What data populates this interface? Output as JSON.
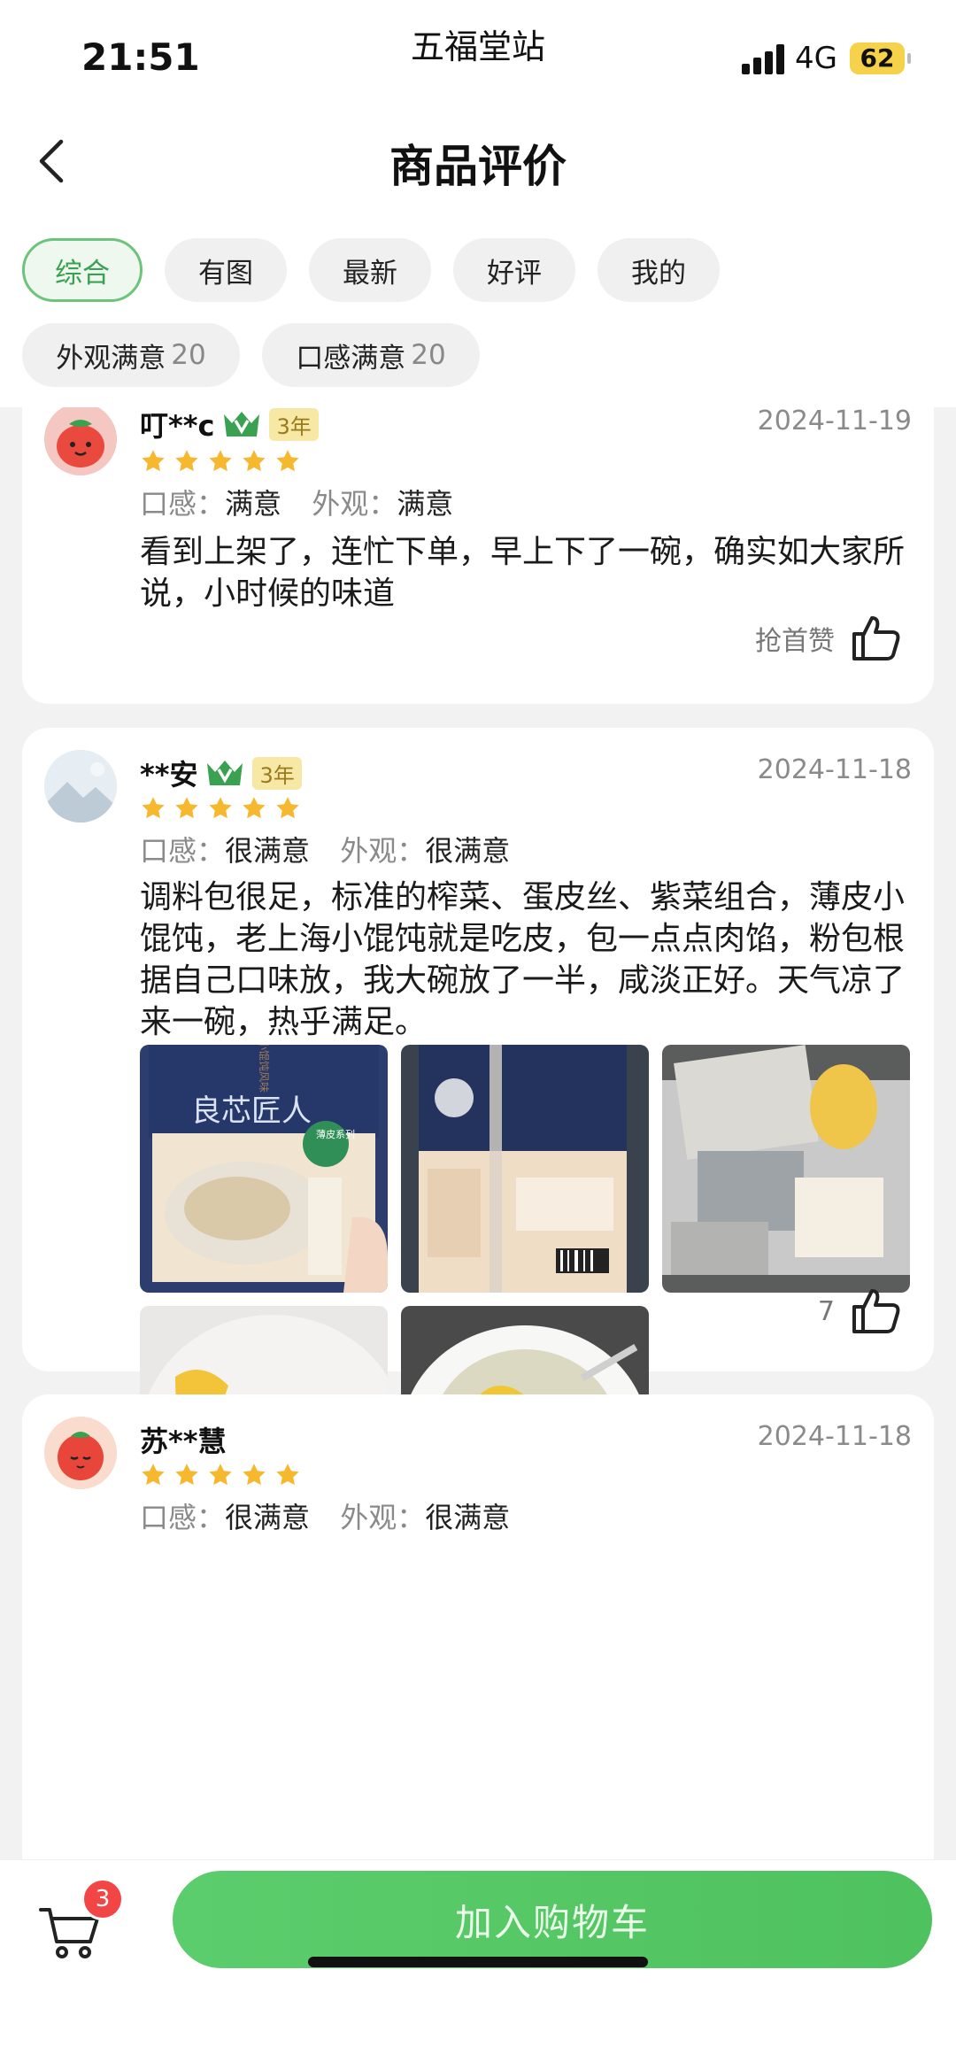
{
  "status_bar": {
    "time": "21:51",
    "carrier": "五福堂站",
    "network": "4G",
    "battery": "62"
  },
  "header": {
    "title": "商品评价"
  },
  "filters": {
    "row1": [
      {
        "label": "综合",
        "active": true
      },
      {
        "label": "有图",
        "active": false
      },
      {
        "label": "最新",
        "active": false
      },
      {
        "label": "好评",
        "active": false
      },
      {
        "label": "我的",
        "active": false
      }
    ],
    "row2": [
      {
        "label": "外观满意",
        "count": "20"
      },
      {
        "label": "口感满意",
        "count": "20"
      }
    ]
  },
  "reviews": [
    {
      "user": "叮**c",
      "years": "3年",
      "date": "2024-11-19",
      "rating": 5,
      "taste_key": "口感",
      "taste_val": "满意",
      "look_key": "外观",
      "look_val": "满意",
      "text": "看到上架了，连忙下单，早上下了一碗，确实如大家所说，小时候的味道",
      "like_label": "抢首赞"
    },
    {
      "user": "**安",
      "years": "3年",
      "date": "2024-11-18",
      "rating": 5,
      "taste_key": "口感",
      "taste_val": "很满意",
      "look_key": "外观",
      "look_val": "很满意",
      "text": "调料包很足，标准的榨菜、蛋皮丝、紫菜组合，薄皮小馄饨，老上海小馄饨就是吃皮，包一点点肉馅，粉包根据自己口味放，我大碗放了一半，咸淡正好。天气凉了来一碗，热乎满足。",
      "like_label": "7",
      "photo_texts": {
        "brand": "良芯匠人",
        "series": "薄皮系列",
        "flavor": "老上海小馄饨风味"
      }
    },
    {
      "user": "苏**慧",
      "date": "2024-11-18",
      "rating": 5,
      "taste_key": "口感",
      "taste_val": "很满意",
      "look_key": "外观",
      "look_val": "很满意"
    }
  ],
  "bottom_bar": {
    "cart_count": "3",
    "add_to_cart": "加入购物车"
  },
  "colors": {
    "accent": "#4ec25e",
    "star": "#f5b82e",
    "badge": "#f24646"
  }
}
